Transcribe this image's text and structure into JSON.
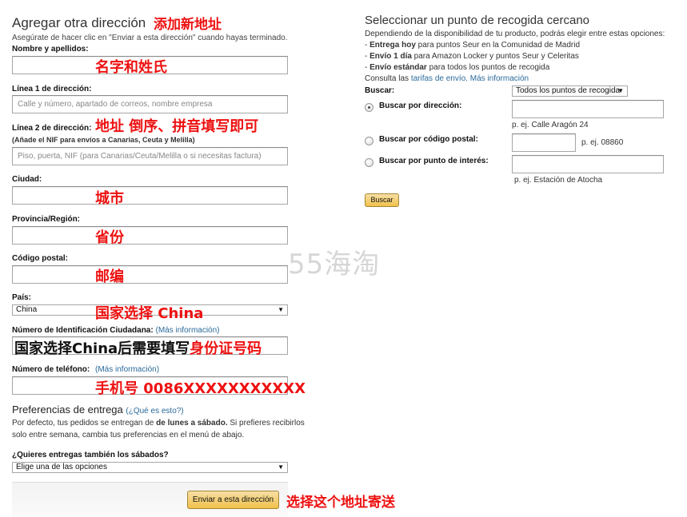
{
  "left": {
    "title": "Agregar otra dirección",
    "title_note": "添加新地址",
    "instructions": "Asegúrate de hacer clic en \"Enviar a esta dirección\" cuando hayas terminado.",
    "name_label": "Nombre y apellidos:",
    "name_note": "名字和姓氏",
    "address1_label": "Línea 1 de dirección:",
    "address1_placeholder": "Calle y número, apartado de correos, nombre empresa",
    "address2_label": "Línea 2 de dirección:",
    "address2_note": "地址 倒序、拼音填写即可",
    "address2_sub": "(Añade el NIF para envíos a Canarias, Ceuta y Melilla)",
    "address2_placeholder": "Piso, puerta, NIF (para Canarias/Ceuta/Melilla o si necesitas factura)",
    "city_label": "Ciudad:",
    "city_note": "城市",
    "province_label": "Provincia/Región:",
    "province_note": "省份",
    "postal_label": "Código postal:",
    "postal_note": "邮编",
    "country_label": "País:",
    "country_value": "China",
    "country_note": "国家选择 China",
    "id_label": "Número de Identificación Ciudadana:",
    "id_link": "(Más información)",
    "id_note_black": "国家选择China后需要填写",
    "id_note_red": "身份证号码",
    "phone_label": "Número de teléfono:",
    "phone_link": "(Más información)",
    "phone_note": "手机号 0086XXXXXXXXXXX",
    "pref_title": "Preferencias de entrega",
    "pref_link": "(¿Qué es esto?)",
    "pref_text1a": "Por defecto, tus pedidos se entregan de ",
    "pref_text1b": "de lunes a sábado.",
    "pref_text1c": " Si prefieres recibirlos",
    "pref_text2": "solo entre semana, cambia tus preferencias en el menú de abajo.",
    "saturday_label": "¿Quieres entregas también los sábados?",
    "saturday_value": "Elige una de las opciones",
    "submit_label": "Enviar a esta dirección",
    "submit_note": "选择这个地址寄送"
  },
  "right": {
    "title": "Seleccionar un punto de recogida cercano",
    "intro": "Dependiendo de la disponibilidad de tu producto, podrás elegir entre estas opciones:",
    "opt1_bold": "Entrega hoy",
    "opt1_rest": " para puntos Seur en la Comunidad de Madrid",
    "opt2_bold": "Envío 1 día",
    "opt2_rest": " para Amazon Locker y puntos Seur y Celeritas",
    "opt3_bold": "Envío estándar",
    "opt3_rest": " para todos los puntos de recogida",
    "consult_prefix": "Consulta las ",
    "consult_link1": "tarifas de envío.",
    "consult_link2": "Más información",
    "search_label": "Buscar:",
    "search_select": "Todos los puntos de recogida",
    "by_address_label": "Buscar por dirección:",
    "by_address_example": "p. ej. Calle Aragón 24",
    "by_postal_label": "Buscar por código postal:",
    "by_postal_example": "p. ej. 08860",
    "by_poi_label": "Buscar por punto de interés:",
    "by_poi_example": "p. ej. Estación de Atocha",
    "search_button": "Buscar"
  },
  "watermark": "55海淘"
}
